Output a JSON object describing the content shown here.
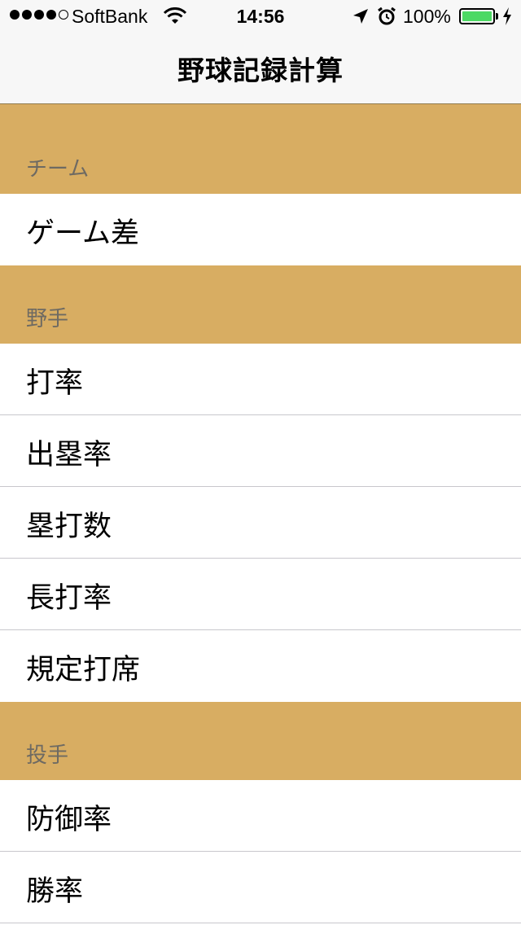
{
  "status_bar": {
    "carrier": "SoftBank",
    "time": "14:56",
    "battery": "100%",
    "battery_color": "#4cd964"
  },
  "nav": {
    "title": "野球記録計算"
  },
  "sections": [
    {
      "header": "チーム",
      "items": [
        "ゲーム差"
      ]
    },
    {
      "header": "野手",
      "items": [
        "打率",
        "出塁率",
        "塁打数",
        "長打率",
        "規定打席"
      ]
    },
    {
      "header": "投手",
      "items": [
        "防御率",
        "勝率"
      ]
    }
  ],
  "colors": {
    "section_header_bg": "#d8ad62",
    "nav_bg": "#f7f7f7"
  }
}
